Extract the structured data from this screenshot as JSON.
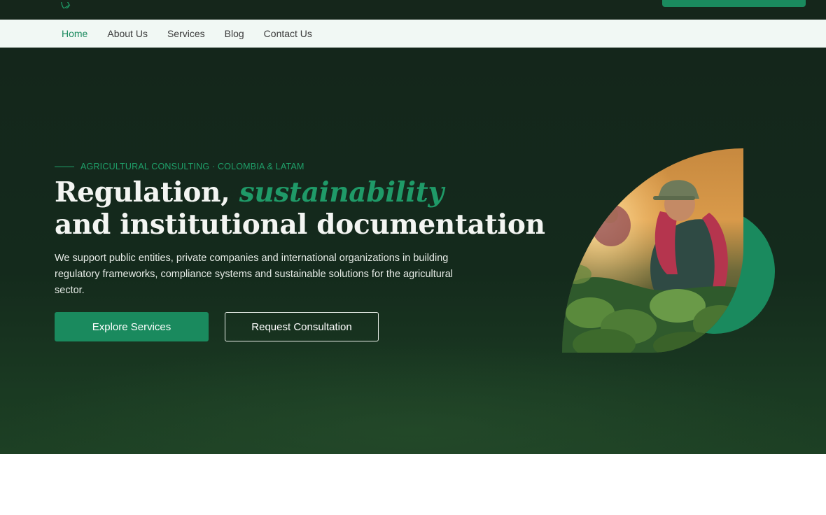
{
  "nav": {
    "items": [
      {
        "label": "Home",
        "active": true
      },
      {
        "label": "About Us",
        "active": false
      },
      {
        "label": "Services",
        "active": false
      },
      {
        "label": "Blog",
        "active": false
      },
      {
        "label": "Contact Us",
        "active": false
      }
    ]
  },
  "hero": {
    "eyebrow": "AGRICULTURAL CONSULTING · COLOMBIA & LATAM",
    "title_part1": "Regulation, ",
    "title_accent": "sustainability",
    "title_line2": "and institutional documentation",
    "lede": "We support public entities, private companies and international organizations in building regulatory frameworks, compliance systems and sustainable solutions for the agricultural sector.",
    "primary_cta": "Explore Services",
    "secondary_cta": "Request Consultation"
  },
  "colors": {
    "brand": "#1a8a5e",
    "hero_bg": "#14261b",
    "nav_bg": "#f1f8f4"
  },
  "icons": {
    "logo": "leaf-logo-icon"
  }
}
